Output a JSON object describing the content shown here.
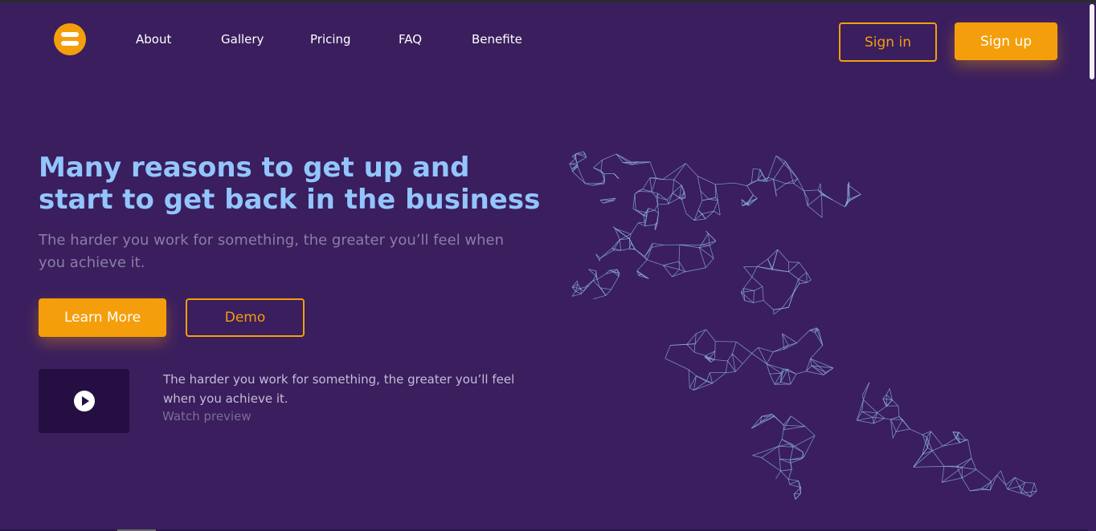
{
  "nav": {
    "links": [
      "About",
      "Gallery",
      "Pricing",
      "FAQ",
      "Benefite"
    ],
    "sign_in": "Sign in",
    "sign_up": "Sign up"
  },
  "hero": {
    "title": "Many reasons to get up and start to get back in the business",
    "subtitle": "The harder you work for something, the greater you’ll feel when you achieve it.",
    "learn_more": "Learn More",
    "demo": "Demo"
  },
  "video": {
    "text": "The harder you work for something, the greater you’ll feel when you achieve it.",
    "watch": "Watch preview"
  },
  "icons": {
    "logo": "menu-icon",
    "play": "play-icon",
    "illustration": "wireframe-runner-illustration"
  },
  "colors": {
    "background": "#3a1e5e",
    "accent": "#f59e0b",
    "title": "#93c5fd",
    "muted": "#8a7fa5",
    "video_bg": "#250f42",
    "mesh": "#8fb6e0"
  }
}
